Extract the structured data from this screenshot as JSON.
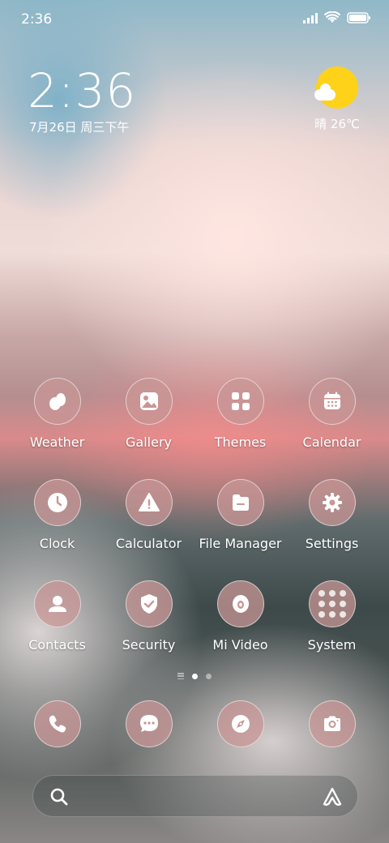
{
  "status_bar": {
    "time": "2:36"
  },
  "lock_clock": {
    "time": "2:36",
    "date": "7月26日 周三下午"
  },
  "weather_widget": {
    "condition_temp": "晴 26℃",
    "sun_color": "#ffd21a"
  },
  "apps": [
    {
      "label": "Weather",
      "icon": "weather-icon"
    },
    {
      "label": "Gallery",
      "icon": "gallery-icon"
    },
    {
      "label": "Themes",
      "icon": "themes-icon"
    },
    {
      "label": "Calendar",
      "icon": "calendar-icon"
    },
    {
      "label": "Clock",
      "icon": "clock-icon"
    },
    {
      "label": "Calculator",
      "icon": "calculator-icon"
    },
    {
      "label": "File Manager",
      "icon": "file-manager-icon"
    },
    {
      "label": "Settings",
      "icon": "settings-icon"
    },
    {
      "label": "Contacts",
      "icon": "contacts-icon"
    },
    {
      "label": "Security",
      "icon": "security-icon"
    },
    {
      "label": "Mi Video",
      "icon": "mi-video-icon"
    },
    {
      "label": "System",
      "icon": "system-folder-icon"
    }
  ],
  "dock": [
    {
      "icon": "phone-icon"
    },
    {
      "icon": "messages-icon"
    },
    {
      "icon": "browser-icon"
    },
    {
      "icon": "camera-icon"
    }
  ],
  "page_indicator": {
    "active_page": 1,
    "total_pages": 2
  },
  "colors": {
    "icon_bg": "#c89696"
  }
}
